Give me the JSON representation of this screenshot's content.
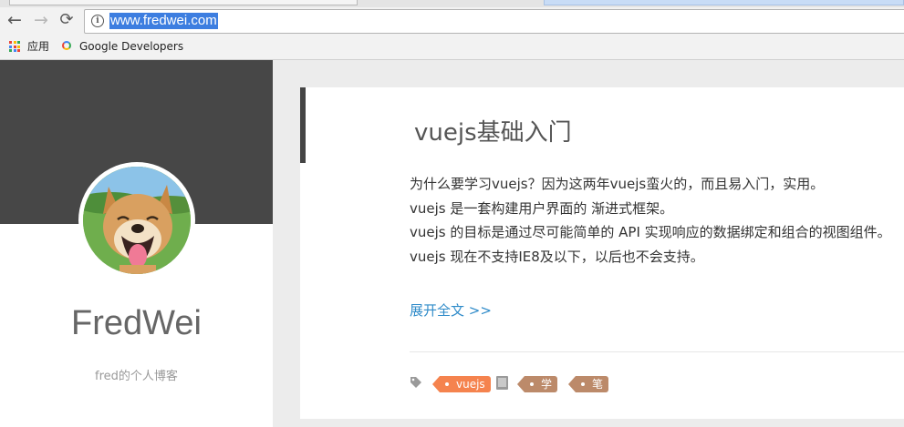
{
  "browser": {
    "url": "www.fredwei.com",
    "bookmarks": {
      "apps_label": "应用",
      "items": [
        {
          "label": "Google Developers"
        }
      ]
    }
  },
  "sidebar": {
    "blog_name": "FredWei",
    "blog_description": "fred的个人博客"
  },
  "post": {
    "title": "vuejs基础入门",
    "excerpt_lines": [
      "为什么要学习vuejs？因为这两年vuejs蛮火的，而且易入门，实用。",
      "vuejs 是一套构建用户界面的 渐进式框架。",
      "vuejs 的目标是通过尽可能简单的 API 实现响应的数据绑定和组合的视图组件。",
      "vuejs 现在不支持IE8及以下，以后也不会支持。"
    ],
    "read_more": "展开全文 >>",
    "tags": [
      {
        "label": "vuejs",
        "color": "#f5834e"
      }
    ],
    "categories": [
      {
        "label": "学习",
        "color": "#bc8a6a"
      },
      {
        "label": "笔记",
        "color": "#bc8a6a"
      }
    ]
  }
}
